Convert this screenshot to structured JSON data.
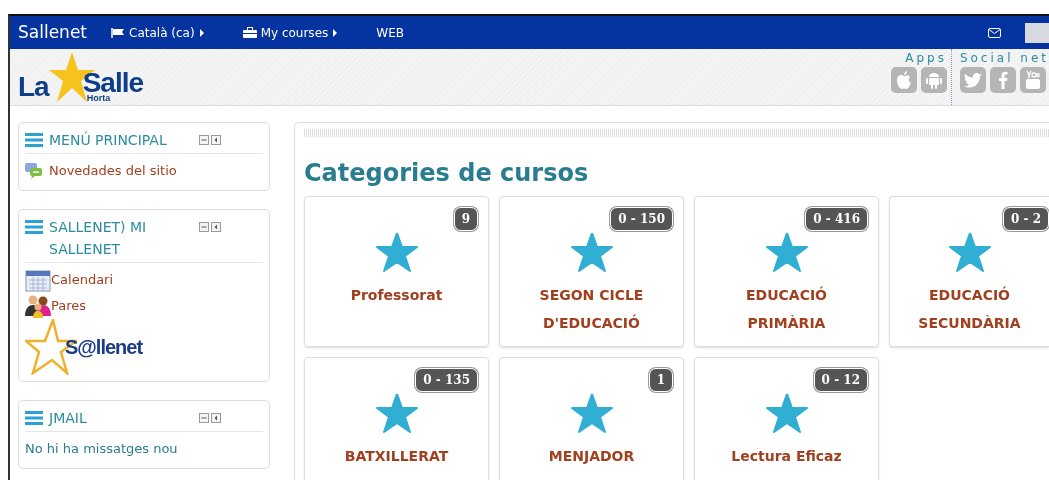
{
  "navbar": {
    "brand": "Sallenet",
    "items": [
      {
        "label": "Català (ca)",
        "kind": "language"
      },
      {
        "label": "My courses",
        "kind": "courses"
      },
      {
        "label": "WEB",
        "kind": "link"
      }
    ]
  },
  "header": {
    "logo": {
      "word_1": "La",
      "word_2": "Salle",
      "subtitle": "Horta"
    },
    "apps_title": "Apps",
    "social_title": "Social net"
  },
  "blocks": [
    {
      "title": "MENÚ PRINCIPAL",
      "items": [
        {
          "label": "Novedades del sitio",
          "kind": "news"
        }
      ]
    },
    {
      "title": "SALLENET) MI SALLENET",
      "items": [
        {
          "label": "Calendari",
          "kind": "calendar"
        },
        {
          "label": "Pares",
          "kind": "parents"
        },
        {
          "label": "S@llenet",
          "kind": "logo"
        }
      ]
    },
    {
      "title": "JMAIL",
      "items": [
        {
          "label": "No hi ha missatges nou",
          "kind": "note"
        }
      ]
    }
  ],
  "main": {
    "title": "Categories de cursos",
    "categories": [
      {
        "name": "Professorat",
        "count": "9"
      },
      {
        "name": "SEGON CICLE D'EDUCACIÓ",
        "count": "0 - 150"
      },
      {
        "name": "EDUCACIÓ PRIMÀRIA",
        "count": "0 - 416"
      },
      {
        "name": "EDUCACIÓ SECUNDÀRIA",
        "count": "0 - 2"
      },
      {
        "name": "BATXILLERAT",
        "count": "0 - 135"
      },
      {
        "name": "MENJADOR",
        "count": "1"
      },
      {
        "name": "Lectura Eficaz",
        "count": "0 - 12"
      }
    ]
  }
}
